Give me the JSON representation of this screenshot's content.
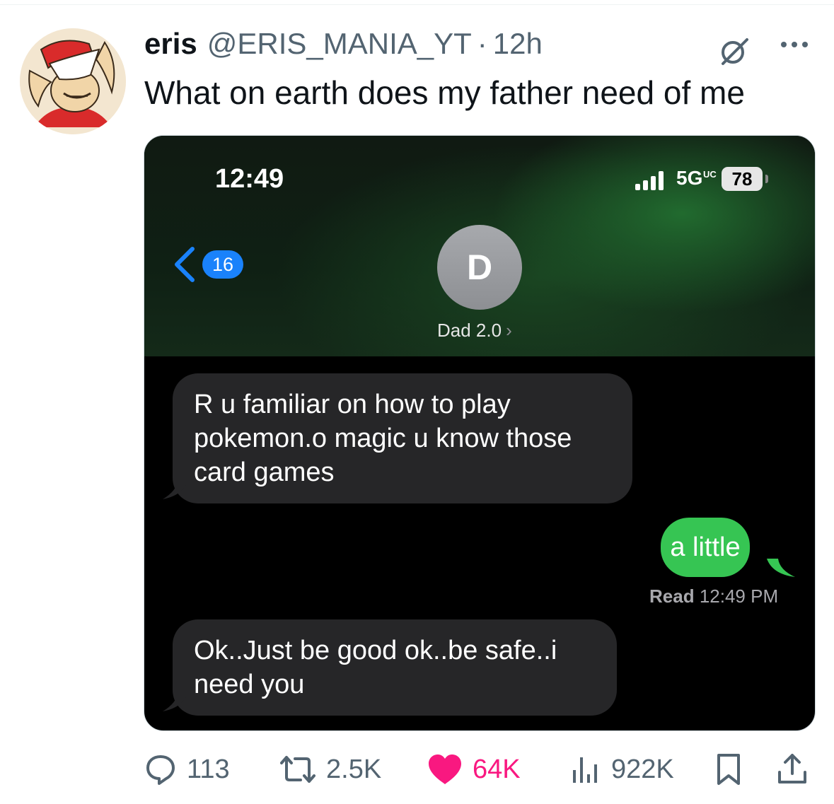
{
  "post": {
    "author_name": "eris",
    "author_handle": "@ERIS_MANIA_YT",
    "separator": "·",
    "time_ago": "12h",
    "text": "What on earth does my father need of me"
  },
  "phone": {
    "status_time": "12:49",
    "network": "5G",
    "network_badge": "UC",
    "battery": "78",
    "back_count": "16",
    "contact_initial": "D",
    "contact_name": "Dad 2.0",
    "contact_chevron": "›"
  },
  "messages": [
    {
      "from": "dad",
      "text": "R u familiar on how to play pokemon.o magic u know those card games"
    },
    {
      "from": "me",
      "text": "a little"
    },
    {
      "from": "dad",
      "text": "Ok..Just be good ok..be safe..i need you"
    }
  ],
  "read_receipt": {
    "label": "Read",
    "time": "12:49 PM"
  },
  "actions": {
    "replies": "113",
    "reposts": "2.5K",
    "likes": "64K",
    "views": "922K"
  },
  "icons": {
    "reply": "reply-icon",
    "repost": "repost-icon",
    "like": "heart-icon",
    "views": "views-icon",
    "bookmark": "bookmark-icon",
    "share": "share-icon",
    "grok": "grok-icon",
    "more": "more-icon"
  },
  "colors": {
    "like_active": "#f91880",
    "imessage_blue": "#1a82fb",
    "sms_green": "#36c553",
    "muted_text": "#536471"
  }
}
